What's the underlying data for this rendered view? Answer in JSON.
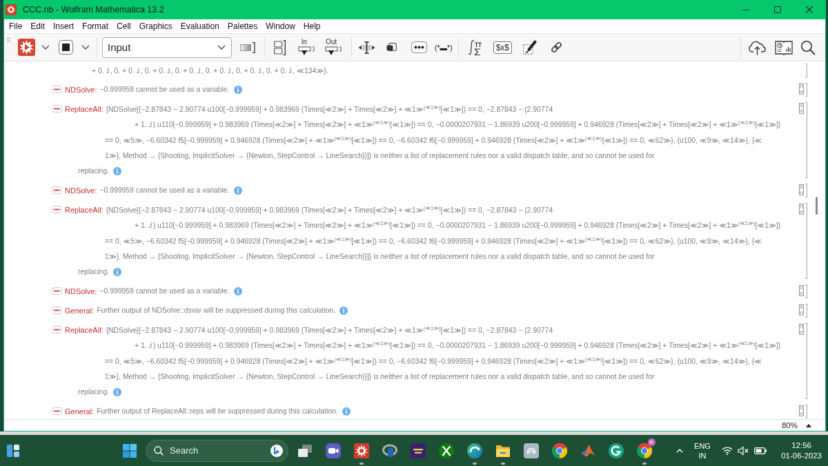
{
  "window": {
    "title": "CCC.nb - Wolfram Mathematica 13.2"
  },
  "menu": [
    "File",
    "Edit",
    "Insert",
    "Format",
    "Cell",
    "Graphics",
    "Evaluation",
    "Palettes",
    "Window",
    "Help"
  ],
  "toolbar": {
    "style": "Input",
    "in_label": "In",
    "out_label": "Out",
    "comment_label": "(*▬*)",
    "tex_label": "$x$"
  },
  "notebook": {
    "messages": [
      {
        "kind": "tail",
        "lines": [
          {
            "kind": "tail",
            "text": "+ 0. ⅈ, 0. + 0. ⅈ, 0. + 0. ⅈ, 0. + 0. ⅈ, 0. + 0. ⅈ, 0. + 0. ⅈ, 0. + 0. ⅈ, ≪134≫}."
          }
        ]
      },
      {
        "kind": "message",
        "source": "NDSolve:",
        "lines": [
          {
            "kind": "first",
            "text": "−0.999959 cannot be used as a variable."
          }
        ]
      },
      {
        "kind": "message",
        "source": "ReplaceAll:",
        "lines": [
          {
            "kind": "first",
            "text": "{NDSolve[{−2.87843 − 2.90774 u100[−0.999959] + 0.983969 (Times[≪2≫] + Times[≪2≫] + ≪1≫$^{(≪1≫)}$[≪1≫]) == 0, −2.87843 − (2.90774"
          },
          {
            "kind": "deep",
            "text": "+ 1. ⅈ) u110[−0.999959] + 0.983969 (Times[≪2≫] + Times[≪2≫] + ≪1≫$^{(≪1≫)}$[≪1≫]) == 0, −0.0000207931 − 1.86939 u200[−0.999959] + 0.946928 (Times[≪2≫] + Times[≪2≫] + ≪1≫$^{(≪1≫)}$[≪1≫])"
          },
          {
            "kind": "wrap",
            "text": "== 0, ≪5≫, −6.60342 f5[−0.999959] + 0.946928 (Times[≪2≫] + ≪1≫$^{(≪1≫)}$[≪1≫]) == 0, −6.60342 f6[−0.999959] + 0.946928 (Times[≪2≫] + ≪1≫$^{(≪1≫)}$[≪1≫]) == 0, ≪62≫}, {u100, ≪9≫, ≪14≫}, {≪"
          },
          {
            "kind": "wrap",
            "text": "1≫}, Method → {Shooting, ImplicitSolver → {Newton, StepControl → LineSearch}}]} is neither a list of replacement rules nor a valid dispatch table, and so cannot be used for"
          },
          {
            "kind": "last",
            "text": "replacing."
          }
        ]
      },
      {
        "kind": "message",
        "source": "NDSolve:",
        "lines": [
          {
            "kind": "first",
            "text": "−0.999959 cannot be used as a variable."
          }
        ]
      },
      {
        "kind": "message",
        "source": "ReplaceAll:",
        "lines": [
          {
            "kind": "first",
            "text": "{NDSolve[{−2.87843 − 2.90774 u100[−0.999959] + 0.983969 (Times[≪2≫] + Times[≪2≫] + ≪1≫$^{(≪1≫)}$[≪1≫]) == 0, −2.87843 − (2.90774"
          },
          {
            "kind": "deep",
            "text": "+ 1. ⅈ) u110[−0.999959] + 0.983969 (Times[≪2≫] + Times[≪2≫] + ≪1≫$^{(≪1≫)}$[≪1≫]) == 0, −0.0000207931 − 1.86939 u200[−0.999959] + 0.946928 (Times[≪2≫] + Times[≪2≫] + ≪1≫$^{(≪1≫)}$[≪1≫])"
          },
          {
            "kind": "wrap",
            "text": "== 0, ≪5≫, −6.60342 f5[−0.999959] + 0.946928 (Times[≪2≫] + ≪1≫$^{(≪1≫)}$[≪1≫]) == 0, −6.60342 f6[−0.999959] + 0.946928 (Times[≪2≫] + ≪1≫$^{(≪1≫)}$[≪1≫]) == 0, ≪62≫}, {u100, ≪9≫, ≪14≫}, {≪"
          },
          {
            "kind": "wrap",
            "text": "1≫}, Method → {Shooting, ImplicitSolver → {Newton, StepControl → LineSearch}}]} is neither a list of replacement rules nor a valid dispatch table, and so cannot be used for"
          },
          {
            "kind": "last",
            "text": "replacing."
          }
        ]
      },
      {
        "kind": "message",
        "source": "NDSolve:",
        "lines": [
          {
            "kind": "first",
            "text": "−0.999959 cannot be used as a variable."
          }
        ]
      },
      {
        "kind": "message",
        "source": "General:",
        "lines": [
          {
            "kind": "first",
            "text": "Further output of NDSolve::dsvar will be suppressed during this calculation."
          }
        ]
      },
      {
        "kind": "message",
        "source": "ReplaceAll:",
        "lines": [
          {
            "kind": "first",
            "text": "{NDSolve[{−2.87843 − 2.90774 u100[−0.999959] + 0.983969 (Times[≪2≫] + Times[≪2≫] + ≪1≫$^{(≪1≫)}$[≪1≫]) == 0, −2.87843 − (2.90774"
          },
          {
            "kind": "deep",
            "text": "+ 1. ⅈ) u110[−0.999959] + 0.983969 (Times[≪2≫] + Times[≪2≫] + ≪1≫$^{(≪1≫)}$[≪1≫]) == 0, −0.0000207931 − 1.86939 u200[−0.999959] + 0.946928 (Times[≪2≫] + Times[≪2≫] + ≪1≫$^{(≪1≫)}$[≪1≫])"
          },
          {
            "kind": "wrap",
            "text": "== 0, ≪5≫, −6.60342 f5[−0.999959] + 0.946928 (Times[≪2≫] + ≪1≫$^{(≪1≫)}$[≪1≫]) == 0, −6.60342 f6[−0.999959] + 0.946928 (Times[≪2≫] + ≪1≫$^{(≪1≫)}$[≪1≫]) == 0, ≪62≫}, {u100, ≪9≫, ≪14≫}, {≪"
          },
          {
            "kind": "wrap",
            "text": "1≫}, Method → {Shooting, ImplicitSolver → {Newton, StepControl → LineSearch}}]} is neither a list of replacement rules nor a valid dispatch table, and so cannot be used for"
          },
          {
            "kind": "last",
            "text": "replacing."
          }
        ]
      },
      {
        "kind": "message",
        "source": "General:",
        "lines": [
          {
            "kind": "first",
            "text": "Further output of ReplaceAll::reps will be suppressed during this calculation."
          }
        ]
      }
    ]
  },
  "status_bar": {
    "zoom": "80%"
  },
  "taskbar": {
    "search": {
      "placeholder": "Search"
    },
    "apps": [
      {
        "kind": "taskview",
        "running": false
      },
      {
        "kind": "camera",
        "running": false
      },
      {
        "kind": "spikey",
        "running": true
      },
      {
        "kind": "ring",
        "running": false
      },
      {
        "kind": "tex",
        "running": false
      },
      {
        "kind": "xball",
        "running": false
      },
      {
        "kind": "wave",
        "running": true
      },
      {
        "kind": "folder",
        "running": true
      },
      {
        "kind": "tile",
        "running": false
      },
      {
        "kind": "chrome",
        "running": false
      },
      {
        "kind": "peak",
        "running": false
      },
      {
        "kind": "arc",
        "running": false
      },
      {
        "kind": "chrome",
        "running": true,
        "badge": "K"
      }
    ],
    "tray": {
      "language": "ENG",
      "region": "IN",
      "time": "12:56",
      "date": "01-06-2023"
    }
  }
}
